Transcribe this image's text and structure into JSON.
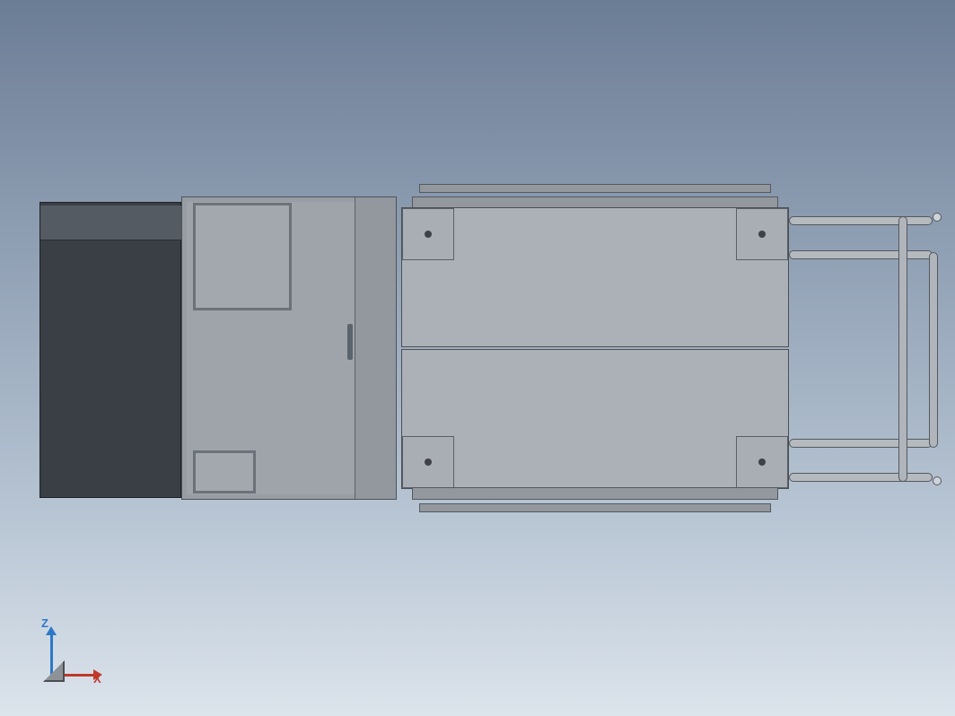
{
  "viewport": {
    "kind": "CAD-orthographic-top-view",
    "axes": {
      "x_label": "X",
      "z_label": "Z"
    }
  }
}
